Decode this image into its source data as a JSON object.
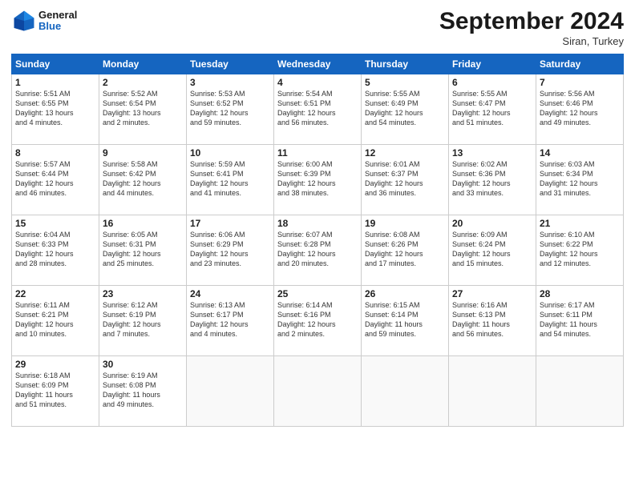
{
  "header": {
    "logo_general": "General",
    "logo_blue": "Blue",
    "title": "September 2024",
    "subtitle": "Siran, Turkey"
  },
  "days_of_week": [
    "Sunday",
    "Monday",
    "Tuesday",
    "Wednesday",
    "Thursday",
    "Friday",
    "Saturday"
  ],
  "weeks": [
    [
      {
        "day": "1",
        "info": "Sunrise: 5:51 AM\nSunset: 6:55 PM\nDaylight: 13 hours\nand 4 minutes."
      },
      {
        "day": "2",
        "info": "Sunrise: 5:52 AM\nSunset: 6:54 PM\nDaylight: 13 hours\nand 2 minutes."
      },
      {
        "day": "3",
        "info": "Sunrise: 5:53 AM\nSunset: 6:52 PM\nDaylight: 12 hours\nand 59 minutes."
      },
      {
        "day": "4",
        "info": "Sunrise: 5:54 AM\nSunset: 6:51 PM\nDaylight: 12 hours\nand 56 minutes."
      },
      {
        "day": "5",
        "info": "Sunrise: 5:55 AM\nSunset: 6:49 PM\nDaylight: 12 hours\nand 54 minutes."
      },
      {
        "day": "6",
        "info": "Sunrise: 5:55 AM\nSunset: 6:47 PM\nDaylight: 12 hours\nand 51 minutes."
      },
      {
        "day": "7",
        "info": "Sunrise: 5:56 AM\nSunset: 6:46 PM\nDaylight: 12 hours\nand 49 minutes."
      }
    ],
    [
      {
        "day": "8",
        "info": "Sunrise: 5:57 AM\nSunset: 6:44 PM\nDaylight: 12 hours\nand 46 minutes."
      },
      {
        "day": "9",
        "info": "Sunrise: 5:58 AM\nSunset: 6:42 PM\nDaylight: 12 hours\nand 44 minutes."
      },
      {
        "day": "10",
        "info": "Sunrise: 5:59 AM\nSunset: 6:41 PM\nDaylight: 12 hours\nand 41 minutes."
      },
      {
        "day": "11",
        "info": "Sunrise: 6:00 AM\nSunset: 6:39 PM\nDaylight: 12 hours\nand 38 minutes."
      },
      {
        "day": "12",
        "info": "Sunrise: 6:01 AM\nSunset: 6:37 PM\nDaylight: 12 hours\nand 36 minutes."
      },
      {
        "day": "13",
        "info": "Sunrise: 6:02 AM\nSunset: 6:36 PM\nDaylight: 12 hours\nand 33 minutes."
      },
      {
        "day": "14",
        "info": "Sunrise: 6:03 AM\nSunset: 6:34 PM\nDaylight: 12 hours\nand 31 minutes."
      }
    ],
    [
      {
        "day": "15",
        "info": "Sunrise: 6:04 AM\nSunset: 6:33 PM\nDaylight: 12 hours\nand 28 minutes."
      },
      {
        "day": "16",
        "info": "Sunrise: 6:05 AM\nSunset: 6:31 PM\nDaylight: 12 hours\nand 25 minutes."
      },
      {
        "day": "17",
        "info": "Sunrise: 6:06 AM\nSunset: 6:29 PM\nDaylight: 12 hours\nand 23 minutes."
      },
      {
        "day": "18",
        "info": "Sunrise: 6:07 AM\nSunset: 6:28 PM\nDaylight: 12 hours\nand 20 minutes."
      },
      {
        "day": "19",
        "info": "Sunrise: 6:08 AM\nSunset: 6:26 PM\nDaylight: 12 hours\nand 17 minutes."
      },
      {
        "day": "20",
        "info": "Sunrise: 6:09 AM\nSunset: 6:24 PM\nDaylight: 12 hours\nand 15 minutes."
      },
      {
        "day": "21",
        "info": "Sunrise: 6:10 AM\nSunset: 6:22 PM\nDaylight: 12 hours\nand 12 minutes."
      }
    ],
    [
      {
        "day": "22",
        "info": "Sunrise: 6:11 AM\nSunset: 6:21 PM\nDaylight: 12 hours\nand 10 minutes."
      },
      {
        "day": "23",
        "info": "Sunrise: 6:12 AM\nSunset: 6:19 PM\nDaylight: 12 hours\nand 7 minutes."
      },
      {
        "day": "24",
        "info": "Sunrise: 6:13 AM\nSunset: 6:17 PM\nDaylight: 12 hours\nand 4 minutes."
      },
      {
        "day": "25",
        "info": "Sunrise: 6:14 AM\nSunset: 6:16 PM\nDaylight: 12 hours\nand 2 minutes."
      },
      {
        "day": "26",
        "info": "Sunrise: 6:15 AM\nSunset: 6:14 PM\nDaylight: 11 hours\nand 59 minutes."
      },
      {
        "day": "27",
        "info": "Sunrise: 6:16 AM\nSunset: 6:13 PM\nDaylight: 11 hours\nand 56 minutes."
      },
      {
        "day": "28",
        "info": "Sunrise: 6:17 AM\nSunset: 6:11 PM\nDaylight: 11 hours\nand 54 minutes."
      }
    ],
    [
      {
        "day": "29",
        "info": "Sunrise: 6:18 AM\nSunset: 6:09 PM\nDaylight: 11 hours\nand 51 minutes."
      },
      {
        "day": "30",
        "info": "Sunrise: 6:19 AM\nSunset: 6:08 PM\nDaylight: 11 hours\nand 49 minutes."
      },
      {
        "day": "",
        "info": ""
      },
      {
        "day": "",
        "info": ""
      },
      {
        "day": "",
        "info": ""
      },
      {
        "day": "",
        "info": ""
      },
      {
        "day": "",
        "info": ""
      }
    ]
  ]
}
